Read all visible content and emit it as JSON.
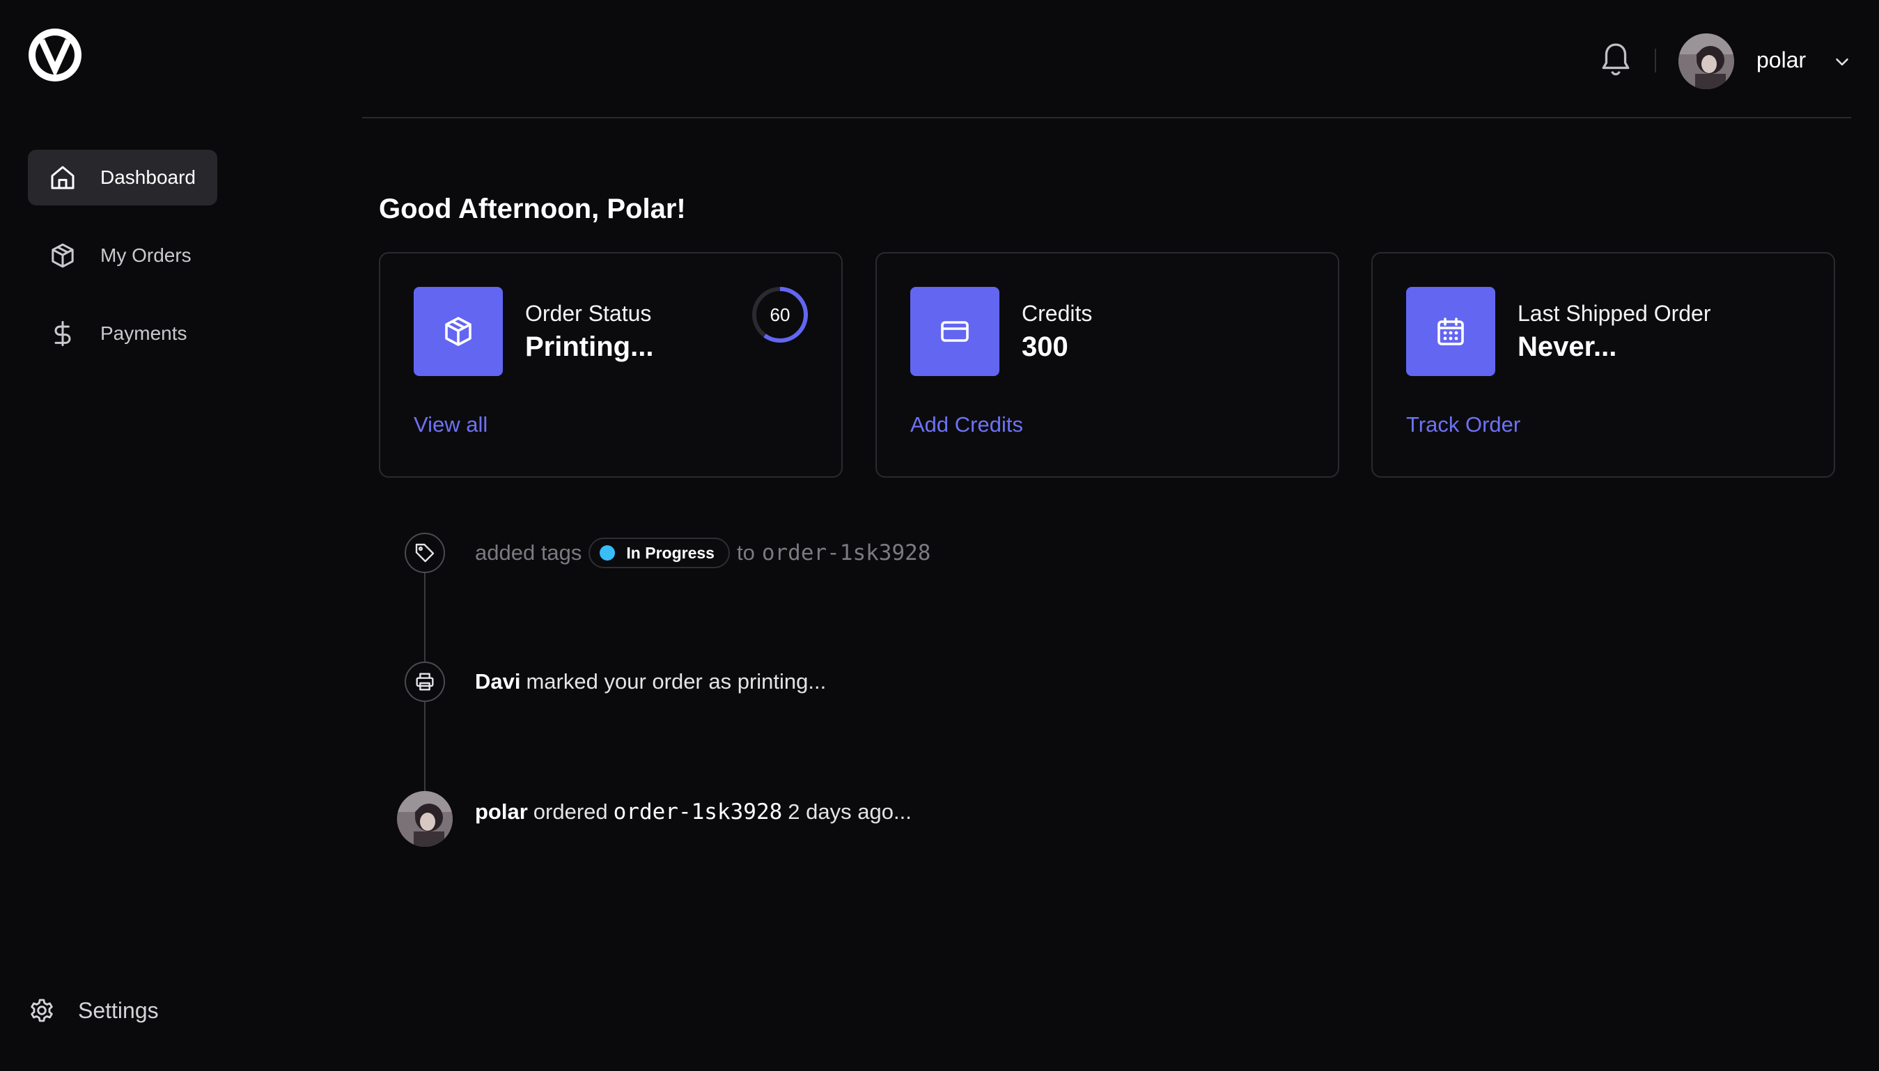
{
  "sidebar": {
    "items": [
      {
        "label": "Dashboard",
        "icon": "home-icon"
      },
      {
        "label": "My Orders",
        "icon": "package-icon"
      },
      {
        "label": "Payments",
        "icon": "dollar-icon"
      }
    ],
    "settings_label": "Settings"
  },
  "header": {
    "username": "polar"
  },
  "main": {
    "greeting": "Good Afternoon, Polar!",
    "cards": [
      {
        "title": "Order Status",
        "value": "Printing...",
        "link": "View all",
        "progress": 60,
        "progress_label": "60"
      },
      {
        "title": "Credits",
        "value": "300",
        "link": "Add Credits"
      },
      {
        "title": "Last Shipped Order",
        "value": "Never...",
        "link": "Track Order"
      }
    ],
    "timeline": {
      "event1": {
        "prefix": "added tags",
        "tag": "In Progress",
        "middle": "to",
        "order": "order-1sk3928"
      },
      "event2": {
        "actor": "Davi",
        "text": "marked your order as printing..."
      },
      "event3": {
        "actor": "polar",
        "text": "ordered",
        "order": "order-1sk3928",
        "suffix": "2 days ago..."
      }
    }
  },
  "colors": {
    "accent": "#6366f1",
    "link": "#6d72f6",
    "tag_dot": "#38bdf8",
    "background": "#0a0a0c"
  }
}
